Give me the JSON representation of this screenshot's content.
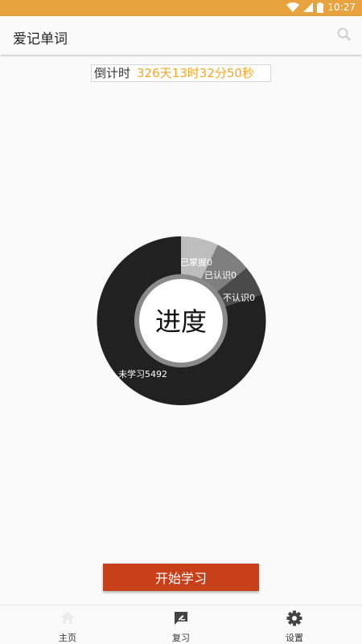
{
  "status_bar": {
    "time": "10:27",
    "color": "#e8a33f"
  },
  "app_bar": {
    "title": "爱记单词",
    "icons": {
      "search": "search-icon"
    }
  },
  "countdown": {
    "label": "倒计时",
    "value": "326天13时32分50秒",
    "value_color": "#f2a826"
  },
  "progress": {
    "center_label": "进度",
    "segments": [
      {
        "label": "已掌握0",
        "value": 0,
        "color": "#bdbdbd"
      },
      {
        "label": "已认识0",
        "value": 0,
        "color": "#7f7f7f"
      },
      {
        "label": "不认识0",
        "value": 0,
        "color": "#4a4a4a"
      },
      {
        "label": "未学习5492",
        "value": 5492,
        "color": "#212121"
      }
    ]
  },
  "start_button": {
    "label": "开始学习",
    "color": "#c8401a"
  },
  "bottom_nav": {
    "items": [
      {
        "label": "主页",
        "icon": "home-icon"
      },
      {
        "label": "复习",
        "icon": "review-icon"
      },
      {
        "label": "设置",
        "icon": "gear-icon"
      }
    ]
  }
}
